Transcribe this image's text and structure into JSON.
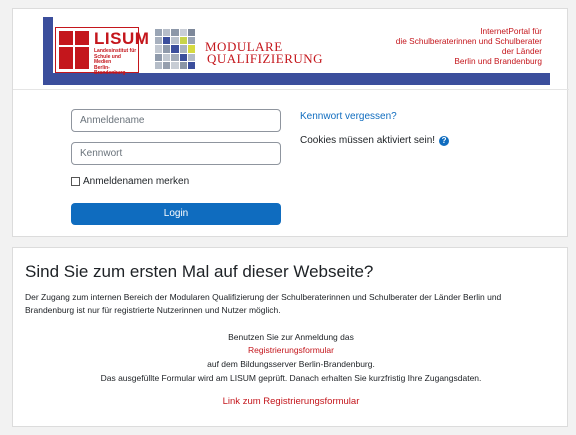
{
  "banner": {
    "lisum_title": "LISUM",
    "lisum_sub": [
      "Landesinstitut für",
      "Schule und Medien",
      "Berlin-Brandenburg"
    ],
    "mq_line1": "MODULARE",
    "mq_line2": "QUALIFIZIERUNG",
    "portal_lines": [
      "InternetPortal für",
      "die Schulberaterinnen und Schulberater",
      "der Länder",
      "Berlin und Brandenburg"
    ],
    "colors": {
      "red": "#c4161c",
      "blue": "#3b4e9c"
    }
  },
  "login": {
    "username_placeholder": "Anmeldename",
    "password_placeholder": "Kennwort",
    "remember_label": "Anmeldenamen merken",
    "login_button": "Login",
    "forgot_link": "Kennwort vergessen?",
    "cookies_text": "Cookies müssen aktiviert sein!",
    "help_icon": "question-circle-icon"
  },
  "info": {
    "title": "Sind Sie zum ersten Mal auf dieser Webseite?",
    "paragraph_line1": "Der Zugang zum internen Bereich der Modularen Qualifizierung der Schulberaterinnen und Schulberater der Länder Berlin und",
    "paragraph_line2": "Brandenburg ist nur für registrierte Nutzerinnen und Nutzer möglich.",
    "use_text": "Benutzen Sie zur Anmeldung das",
    "form_link": "Registrierungsformular",
    "server_text": "auf dem Bildungsserver Berlin-Brandenburg.",
    "check_text": "Das ausgefüllte Formular wird am LISUM geprüft. Danach erhalten Sie kurzfristig Ihre Zugangsdaten.",
    "form_link2": "Link zum Registrierungsformular"
  },
  "colors": {
    "primary": "#0f6cbf",
    "link_red": "#c4161c"
  }
}
